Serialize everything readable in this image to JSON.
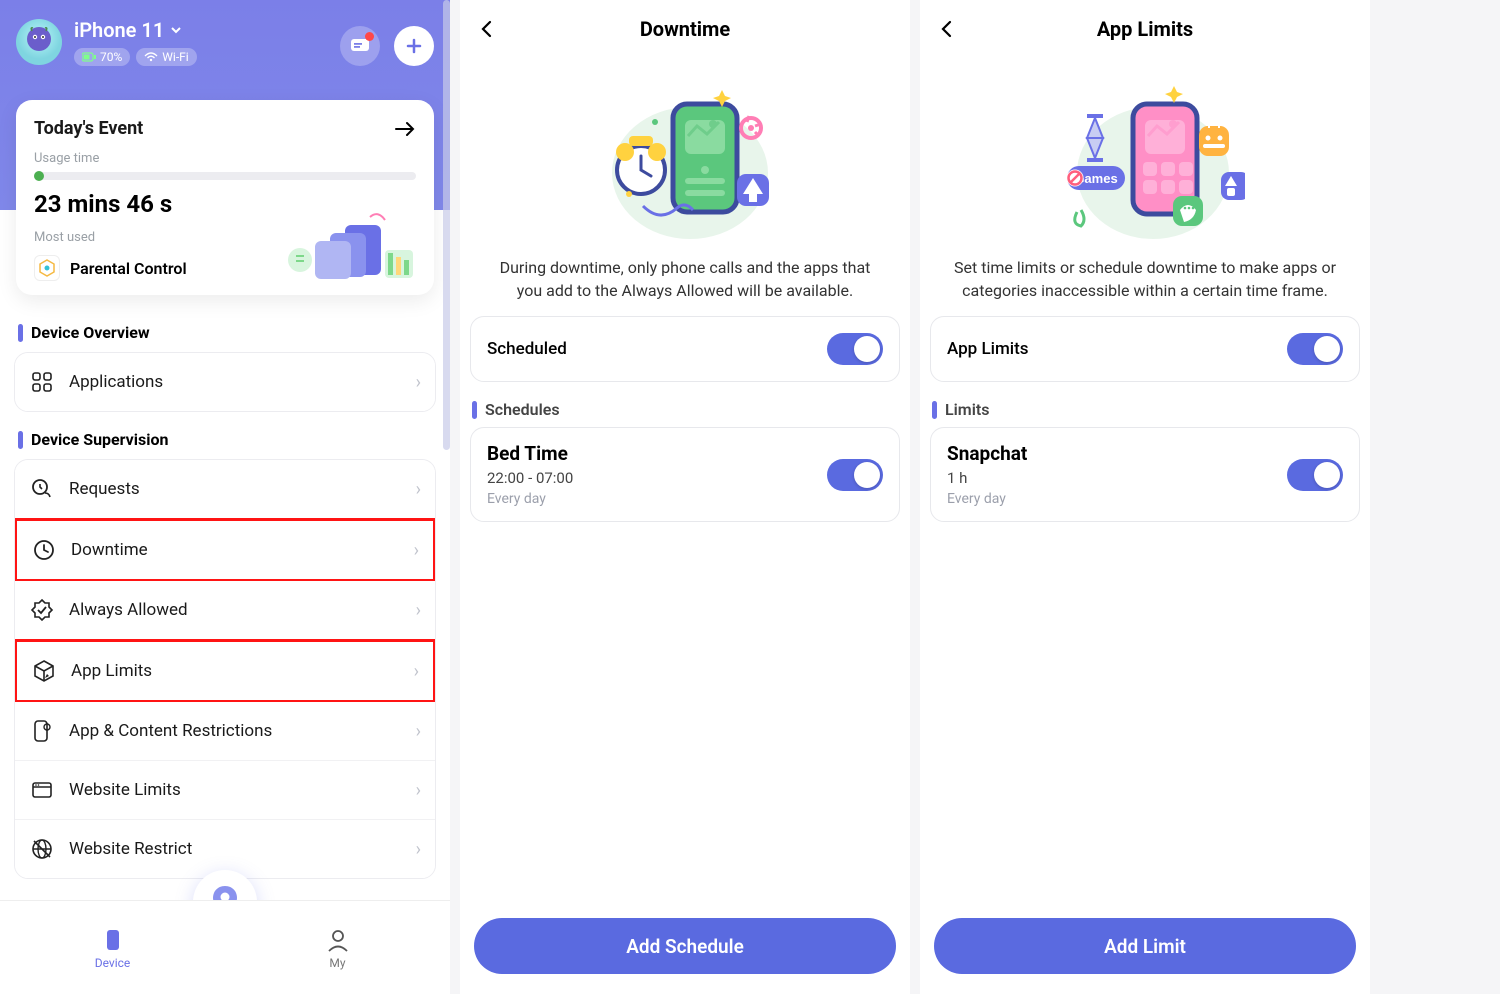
{
  "screen1": {
    "device_name": "iPhone 11",
    "battery": "70%",
    "wifi": "Wi-Fi",
    "event_card": {
      "title": "Today's Event",
      "usage_label": "Usage time",
      "usage_value": "23 mins 46 s",
      "most_used_label": "Most used",
      "most_used_app": "Parental Control"
    },
    "overview_section": "Device Overview",
    "overview_item": "Applications",
    "supervision_section": "Device Supervision",
    "supervision_items": [
      {
        "label": "Requests",
        "icon": "requests",
        "hl": false
      },
      {
        "label": "Downtime",
        "icon": "clock",
        "hl": true
      },
      {
        "label": "Always Allowed",
        "icon": "badge",
        "hl": false
      },
      {
        "label": "App Limits",
        "icon": "cube",
        "hl": true
      },
      {
        "label": "App & Content Restrictions",
        "icon": "phone-gear",
        "hl": false
      },
      {
        "label": "Website Limits",
        "icon": "browser",
        "hl": false
      },
      {
        "label": "Website Restrict",
        "icon": "globe",
        "hl": false
      }
    ],
    "nav": {
      "device": "Device",
      "my": "My"
    }
  },
  "screen2": {
    "title": "Downtime",
    "desc": "During downtime, only phone calls and the apps that you add to the Always Allowed will be available.",
    "scheduled_label": "Scheduled",
    "schedules_head": "Schedules",
    "schedule": {
      "name": "Bed Time",
      "time": "22:00 - 07:00",
      "freq": "Every day"
    },
    "cta": "Add Schedule"
  },
  "screen3": {
    "title": "App Limits",
    "desc": "Set time limits or schedule downtime to make apps or categories inaccessible within a certain time frame.",
    "switch_label": "App Limits",
    "limits_head": "Limits",
    "limit": {
      "name": "Snapchat",
      "time": "1 h",
      "freq": "Every day"
    },
    "cta": "Add Limit"
  }
}
